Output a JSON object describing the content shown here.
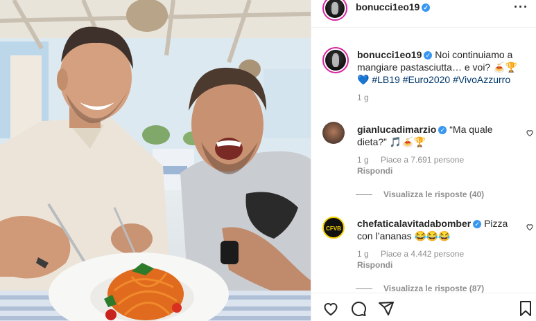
{
  "post": {
    "author": "bonucci1eo19",
    "verified": true,
    "caption_text": "Noi continuiamo a mangiare pastasciutta… e voi? 🍝🏆",
    "caption_heart": "💙",
    "hashtags": [
      "#LB19",
      "#Euro2020",
      "#VivoAzzurro"
    ],
    "age": "1 g"
  },
  "comments": [
    {
      "username": "gianlucadimarzio",
      "verified": true,
      "text": "“Ma quale dieta?” 🎵🍝🏆",
      "age": "1 g",
      "likes": "Piace a 7.691 persone",
      "reply_label": "Rispondi",
      "view_replies": "Visualizza le risposte (40)"
    },
    {
      "username": "chefaticalavitadabomber",
      "verified": true,
      "text": "Pizza con l’ananas 😂😂😂",
      "age": "1 g",
      "likes": "Piace a 4.442 persone",
      "reply_label": "Rispondi",
      "view_replies": "Visualizza le risposte (87)"
    }
  ],
  "avatar_labels": {
    "chefatica": "CFVB"
  },
  "icons": [
    "more-options-icon",
    "like-icon",
    "comment-icon",
    "share-icon",
    "save-icon",
    "verified-badge-icon"
  ],
  "colors": {
    "verified": "#3897f0",
    "hashtag": "#00376b",
    "muted": "#8e8e8e"
  }
}
